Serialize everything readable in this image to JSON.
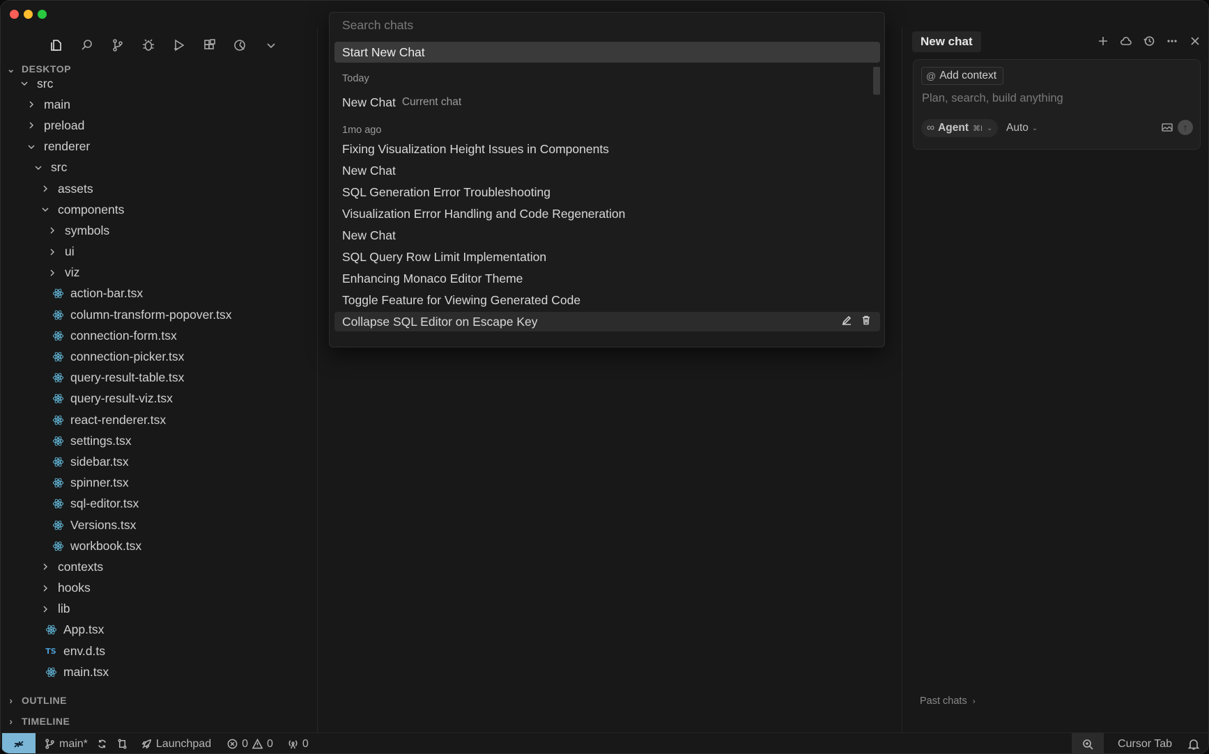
{
  "explorer": {
    "section_title": "DESKTOP",
    "outline_title": "OUTLINE",
    "timeline_title": "TIMELINE",
    "activity_icons": [
      "files-icon",
      "search-icon",
      "source-control-icon",
      "debug-icon",
      "run-icon",
      "extensions-icon",
      "cursor-agent-icon",
      "chevron-down-icon"
    ],
    "tree": [
      {
        "label": "src",
        "depth": 0,
        "kind": "folder",
        "open": true
      },
      {
        "label": "main",
        "depth": 1,
        "kind": "folder",
        "open": false
      },
      {
        "label": "preload",
        "depth": 1,
        "kind": "folder",
        "open": false
      },
      {
        "label": "renderer",
        "depth": 1,
        "kind": "folder",
        "open": true
      },
      {
        "label": "src",
        "depth": 2,
        "kind": "folder",
        "open": true
      },
      {
        "label": "assets",
        "depth": 3,
        "kind": "folder",
        "open": false
      },
      {
        "label": "components",
        "depth": 3,
        "kind": "folder",
        "open": true
      },
      {
        "label": "symbols",
        "depth": 4,
        "kind": "folder",
        "open": false
      },
      {
        "label": "ui",
        "depth": 4,
        "kind": "folder",
        "open": false
      },
      {
        "label": "viz",
        "depth": 4,
        "kind": "folder",
        "open": false
      },
      {
        "label": "action-bar.tsx",
        "depth": 4,
        "kind": "react"
      },
      {
        "label": "column-transform-popover.tsx",
        "depth": 4,
        "kind": "react"
      },
      {
        "label": "connection-form.tsx",
        "depth": 4,
        "kind": "react"
      },
      {
        "label": "connection-picker.tsx",
        "depth": 4,
        "kind": "react"
      },
      {
        "label": "query-result-table.tsx",
        "depth": 4,
        "kind": "react"
      },
      {
        "label": "query-result-viz.tsx",
        "depth": 4,
        "kind": "react"
      },
      {
        "label": "react-renderer.tsx",
        "depth": 4,
        "kind": "react"
      },
      {
        "label": "settings.tsx",
        "depth": 4,
        "kind": "react"
      },
      {
        "label": "sidebar.tsx",
        "depth": 4,
        "kind": "react"
      },
      {
        "label": "spinner.tsx",
        "depth": 4,
        "kind": "react"
      },
      {
        "label": "sql-editor.tsx",
        "depth": 4,
        "kind": "react"
      },
      {
        "label": "Versions.tsx",
        "depth": 4,
        "kind": "react"
      },
      {
        "label": "workbook.tsx",
        "depth": 4,
        "kind": "react"
      },
      {
        "label": "contexts",
        "depth": 3,
        "kind": "folder",
        "open": false
      },
      {
        "label": "hooks",
        "depth": 3,
        "kind": "folder",
        "open": false
      },
      {
        "label": "lib",
        "depth": 3,
        "kind": "folder",
        "open": false
      },
      {
        "label": "App.tsx",
        "depth": 3,
        "kind": "react"
      },
      {
        "label": "env.d.ts",
        "depth": 3,
        "kind": "ts"
      },
      {
        "label": "main.tsx",
        "depth": 3,
        "kind": "react"
      }
    ]
  },
  "picker": {
    "search_placeholder": "Search chats",
    "start_new": "Start New Chat",
    "today_label": "Today",
    "current": {
      "title": "New Chat",
      "tag": "Current chat"
    },
    "older_label": "1mo ago",
    "older": [
      "Fixing Visualization Height Issues in Components",
      "New Chat",
      "SQL Generation Error Troubleshooting",
      "Visualization Error Handling and Code Regeneration",
      "New Chat",
      "SQL Query Row Limit Implementation",
      "Enhancing Monaco Editor Theme",
      "Toggle Feature for Viewing Generated Code",
      "Collapse SQL Editor on Escape Key"
    ]
  },
  "chat": {
    "tab_title": "New chat",
    "add_context": "Add context",
    "placeholder": "Plan, search, build anything",
    "agent_label": "Agent",
    "agent_shortcut": "⌘I",
    "model_label": "Auto",
    "past_chats": "Past chats"
  },
  "status": {
    "branch": "main*",
    "launchpad": "Launchpad",
    "errors": "0",
    "warnings": "0",
    "ports": "0",
    "cursor_tab": "Cursor Tab"
  },
  "colors": {
    "remote_indicator": "#7bb6d6",
    "react_icon": "#61b5d6",
    "ts_icon": "#4b9cd3"
  }
}
